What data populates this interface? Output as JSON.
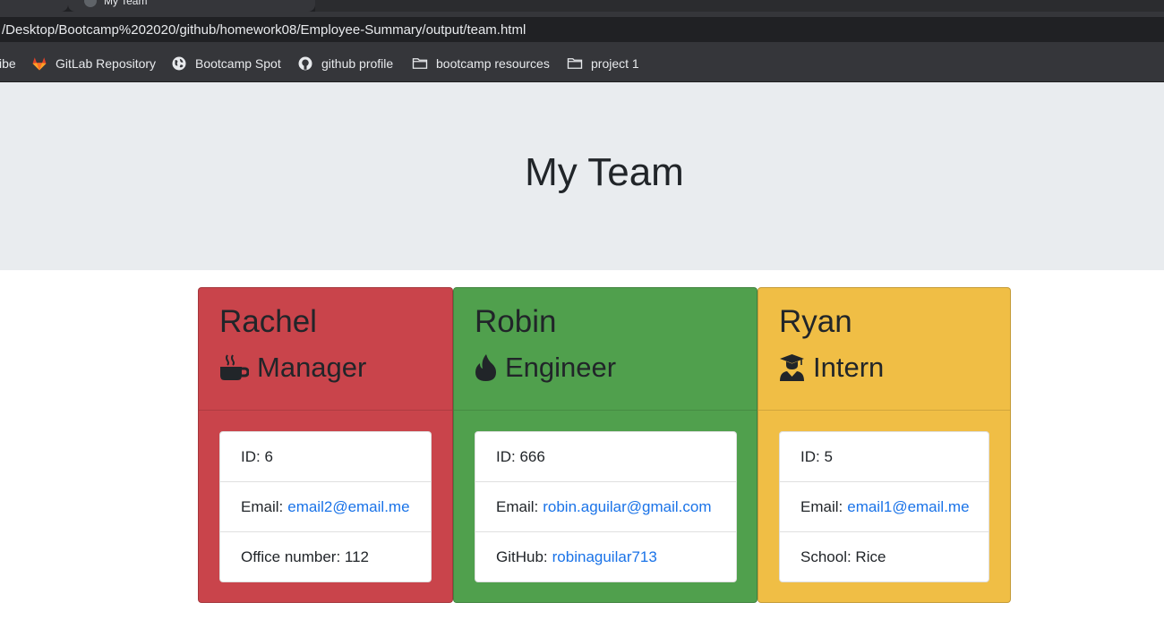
{
  "browser": {
    "tab_title": "My Team",
    "url": "/Desktop/Bootcamp%202020/github/homework08/Employee-Summary/output/team.html",
    "bookmarks": [
      {
        "label": "ibe",
        "icon": ""
      },
      {
        "label": "GitLab Repository",
        "icon": "gitlab-icon"
      },
      {
        "label": "Bootcamp Spot",
        "icon": "globe-icon"
      },
      {
        "label": "github profile",
        "icon": "github-icon"
      },
      {
        "label": "bootcamp resources",
        "icon": "folder-icon"
      },
      {
        "label": "project 1",
        "icon": "folder-icon"
      }
    ]
  },
  "page": {
    "title": "My Team"
  },
  "cards": [
    {
      "name": "Rachel",
      "role": "Manager",
      "role_icon": "mug-icon",
      "color": "#c9444b",
      "id_text": "ID: 6",
      "email_label": "Email:",
      "email": "email2@email.me",
      "extra_text": "Office number: 112"
    },
    {
      "name": "Robin",
      "role": "Engineer",
      "role_icon": "fire-icon",
      "color": "#50a04d",
      "id_text": "ID: 666",
      "email_label": "Email:",
      "email": "robin.aguilar@gmail.com",
      "extra_label": "GitHub:",
      "extra_link": "robinaguilar713"
    },
    {
      "name": "Ryan",
      "role": "Intern",
      "role_icon": "graduate-icon",
      "color": "#f0be45",
      "id_text": "ID: 5",
      "email_label": "Email:",
      "email": "email1@email.me",
      "extra_text": "School: Rice"
    }
  ],
  "colors": {
    "link": "#1a73e8",
    "jumbotron": "#e9ecef"
  }
}
